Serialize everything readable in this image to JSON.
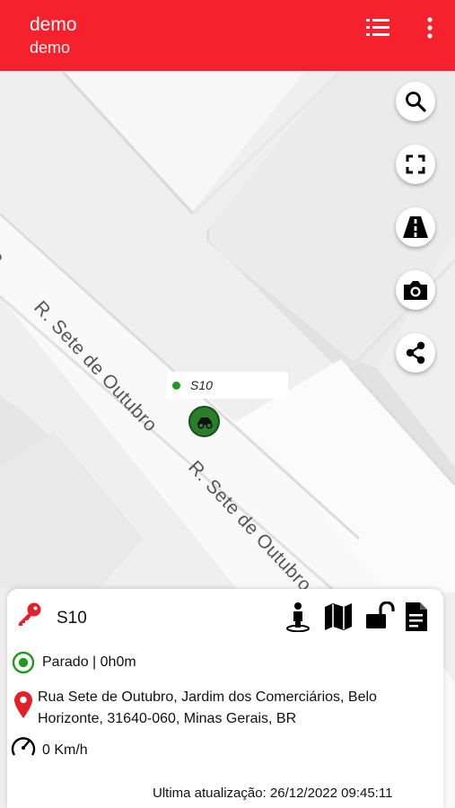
{
  "header": {
    "title": "demo",
    "subtitle": "demo",
    "background_color": "#f5222d",
    "icons": [
      "list-icon",
      "more-vert-icon"
    ]
  },
  "map": {
    "street_labels": [
      "R. Sete de Outubro",
      "R. Sete de Outubro",
      "ro",
      "o"
    ],
    "marker_label": "S10",
    "marker_status_color": "#1e9b1e",
    "buttons": [
      "search-icon",
      "fullscreen-icon",
      "road-icon",
      "camera-icon",
      "share-icon"
    ]
  },
  "panel": {
    "vehicle_name": "S10",
    "status": "Parado |  0h0m",
    "address": "Rua Sete de Outubro, Jardim dos Comerciários, Belo Horizonte, 31640-060, Minas Gerais, BR",
    "speed": "0 Km/h",
    "last_update": "Ultima atualização: 26/12/2022 09:45:11",
    "action_icons": [
      "person-pin-icon",
      "map-icon",
      "lock-open-icon",
      "document-icon"
    ],
    "accent_color": "#e3202a",
    "status_color": "#1e9b1e"
  }
}
